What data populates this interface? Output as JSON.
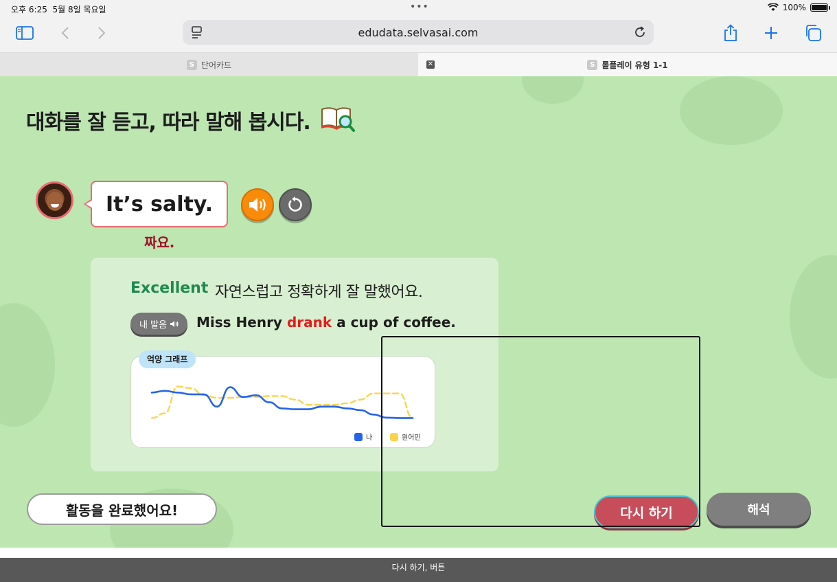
{
  "status_bar": {
    "time": "오후 6:25",
    "date": "5월 8일 목요일",
    "battery": "100%"
  },
  "browser": {
    "url": "edudata.selvasai.com",
    "icons": [
      "sidebar-icon",
      "back-icon",
      "forward-icon",
      "reader-icon",
      "reload-icon",
      "share-icon",
      "new-tab-icon",
      "tabs-icon"
    ]
  },
  "tabs": [
    {
      "favicon": "S",
      "label": "단어카드"
    },
    {
      "favicon": "S",
      "label": "롤플레이 유형 1-1"
    }
  ],
  "lesson": {
    "title": "대화를 잘 듣고, 따라 말해 봅시다.",
    "sentence": "It’s salty.",
    "translation": "짜요."
  },
  "feedback": {
    "grade": "Excellent",
    "message": "자연스럽고 정확하게 잘 말했어요.",
    "pron_button": "내 발음",
    "sentence_parts": {
      "before": "Miss Henry ",
      "wrong": "drank",
      "after": " a cup of coffee."
    }
  },
  "intonation_graph": {
    "tag": "억양 그래프",
    "legend": [
      {
        "name": "나",
        "color": "#2563eb"
      },
      {
        "name": "원어민",
        "color": "#fcd34d"
      }
    ]
  },
  "chart_data": {
    "type": "line",
    "x": [
      0,
      5,
      10,
      15,
      20,
      25,
      30,
      35,
      40,
      45,
      50,
      55,
      60,
      65,
      70,
      75,
      80,
      85,
      90,
      95,
      100
    ],
    "series": [
      {
        "name": "나",
        "values": [
          0.62,
          0.66,
          0.62,
          0.58,
          0.58,
          0.3,
          0.74,
          0.52,
          0.56,
          0.4,
          0.26,
          0.24,
          0.24,
          0.3,
          0.3,
          0.26,
          0.22,
          0.12,
          0.05,
          0.04,
          0.04
        ]
      },
      {
        "name": "원어민",
        "values": [
          0.04,
          0.15,
          0.76,
          0.72,
          0.56,
          0.5,
          0.5,
          0.52,
          0.52,
          0.54,
          0.54,
          0.46,
          0.34,
          0.34,
          0.34,
          0.38,
          0.46,
          0.6,
          0.6,
          0.6,
          0.04
        ]
      }
    ],
    "ylim": [
      0,
      1
    ]
  },
  "actions": {
    "complete": "활동을 완료했어요!",
    "retry": "다시 하기",
    "interpretation": "해석"
  },
  "voiceover": "다시 하기, 버튼"
}
